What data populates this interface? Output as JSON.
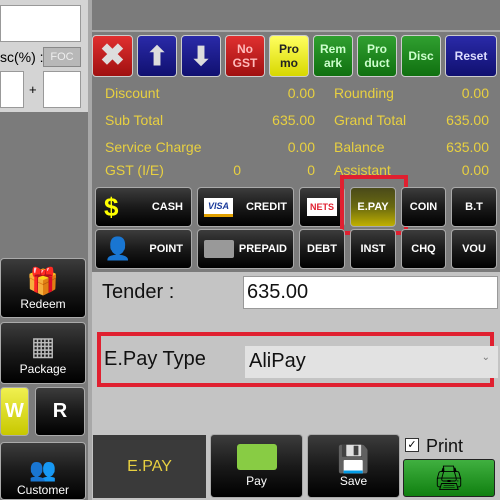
{
  "left": {
    "disc_label": "sc(%) :",
    "foc": "FOC",
    "plus": "+",
    "buttons": {
      "redeem": "Redeem",
      "package": "Package",
      "w": "W",
      "r": "R",
      "customer": "Customer"
    }
  },
  "toolbar": {
    "no_gst": "No GST",
    "promo": "Pro mo",
    "remark": "Rem ark",
    "product": "Pro duct",
    "disc": "Disc",
    "reset": "Reset"
  },
  "summary": {
    "discount": "Discount",
    "discount_val": "0.00",
    "subtotal": "Sub Total",
    "subtotal_val": "635.00",
    "service": "Service Charge",
    "service_val": "0.00",
    "gst": "GST (I/E)",
    "gst_i": "0",
    "gst_e": "0",
    "rounding": "Rounding",
    "rounding_val": "0.00",
    "grand": "Grand Total",
    "grand_val": "635.00",
    "balance": "Balance",
    "balance_val": "635.00",
    "assistant": "Assistant",
    "assistant_val": "0.00"
  },
  "pay": {
    "cash": "CASH",
    "credit": "CREDIT",
    "nets": "NETS",
    "visa": "VISA",
    "epay": "E.PAY",
    "coin": "COIN",
    "bt": "B.T",
    "point": "POINT",
    "prepaid": "PREPAID",
    "debt": "DEBT",
    "inst": "INST",
    "chq": "CHQ",
    "vou": "VOU"
  },
  "tender": {
    "label": "Tender :",
    "value": "635.00"
  },
  "epay_type": {
    "label": "E.Pay Type",
    "selected": "AliPay"
  },
  "bottom": {
    "mode": "E.PAY",
    "pay": "Pay",
    "save": "Save",
    "print": "Print",
    "print_checked": true
  },
  "colors": {
    "accent_yellow": "#e8d040",
    "highlight_red": "#e02030"
  }
}
